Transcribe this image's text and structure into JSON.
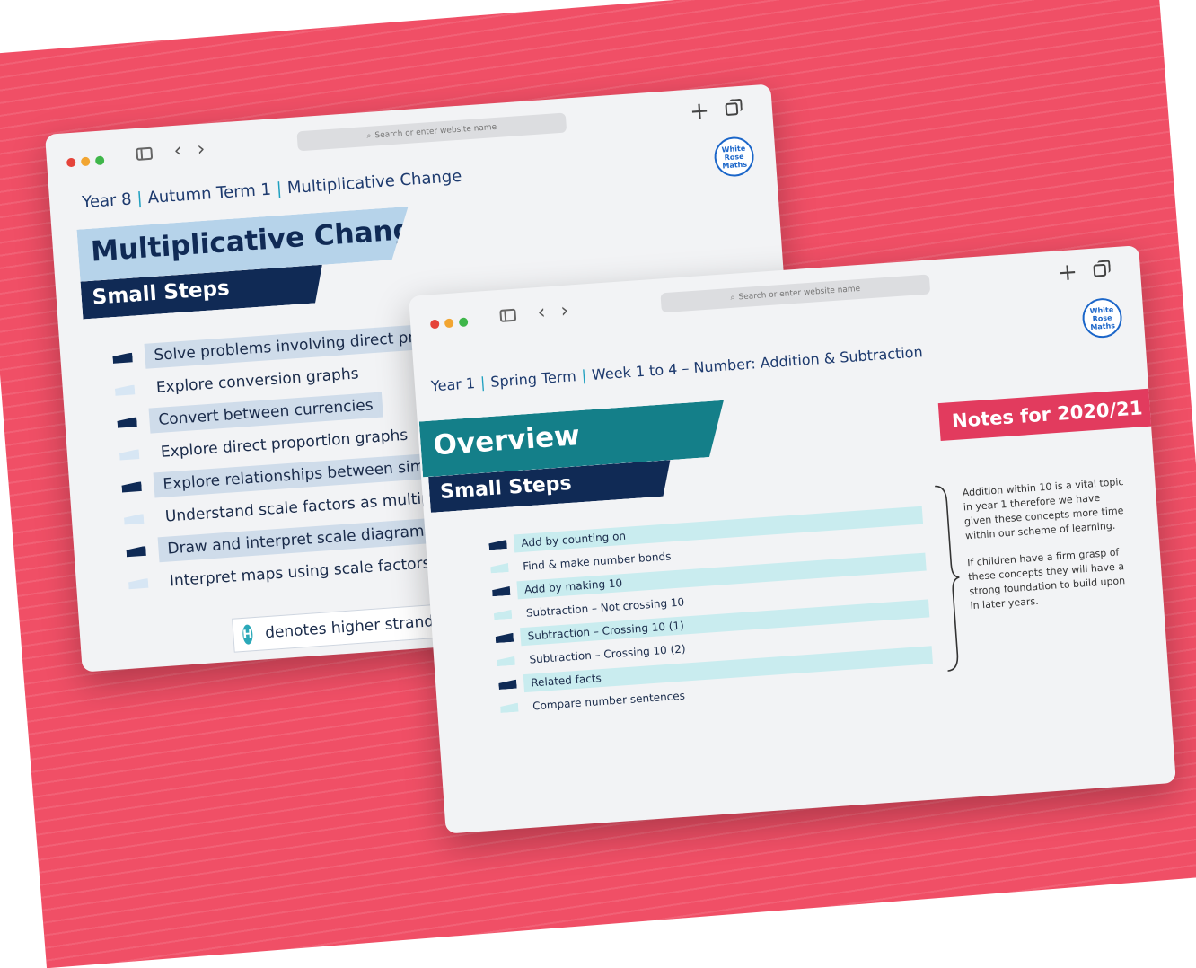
{
  "windows": [
    {
      "id": "year8",
      "search_placeholder": "Search or enter website name",
      "logo": "White Rose Maths",
      "breadcrumb": [
        "Year 8",
        "Autumn Term 1",
        "Multiplicative Change"
      ],
      "title": "Multiplicative Change",
      "subtitle": "Small Steps",
      "steps": [
        "Solve problems involving direct proportion",
        "Explore conversion graphs",
        "Convert between currencies",
        "Explore direct proportion graphs",
        "Explore relationships between similar shapes",
        "Understand scale factors as multiplicative",
        "Draw and interpret scale diagrams",
        "Interpret maps using scale factors and ratios"
      ],
      "footer_icon_letter": "H",
      "footer": "denotes higher strand and not necessarily content for Higher Tier GCSE"
    },
    {
      "id": "year1",
      "search_placeholder": "Search or enter website name",
      "logo": "White Rose Maths",
      "breadcrumb": [
        "Year 1",
        "Spring Term",
        "Week 1 to 4 – Number: Addition & Subtraction"
      ],
      "title": "Overview",
      "subtitle": "Small Steps",
      "steps": [
        "Add by counting on",
        "Find & make number bonds",
        "Add by making 10",
        "Subtraction – Not crossing 10",
        "Subtraction – Crossing 10 (1)",
        "Subtraction – Crossing 10 (2)",
        "Related facts",
        "Compare number sentences"
      ],
      "notes_title": "Notes for 2020/21",
      "notes": [
        "Addition within 10 is a vital topic in year 1 therefore we have given these concepts more time within our scheme of learning.",
        "If children have a firm grasp of these concepts they will have a strong foundation to build upon in later years."
      ]
    }
  ],
  "colors": {
    "background": "#f04f66",
    "navy": "#102a55",
    "light_blue_band": "#b6d3ea",
    "teal_band": "#147f89",
    "notes_pink": "#e23b5e"
  }
}
